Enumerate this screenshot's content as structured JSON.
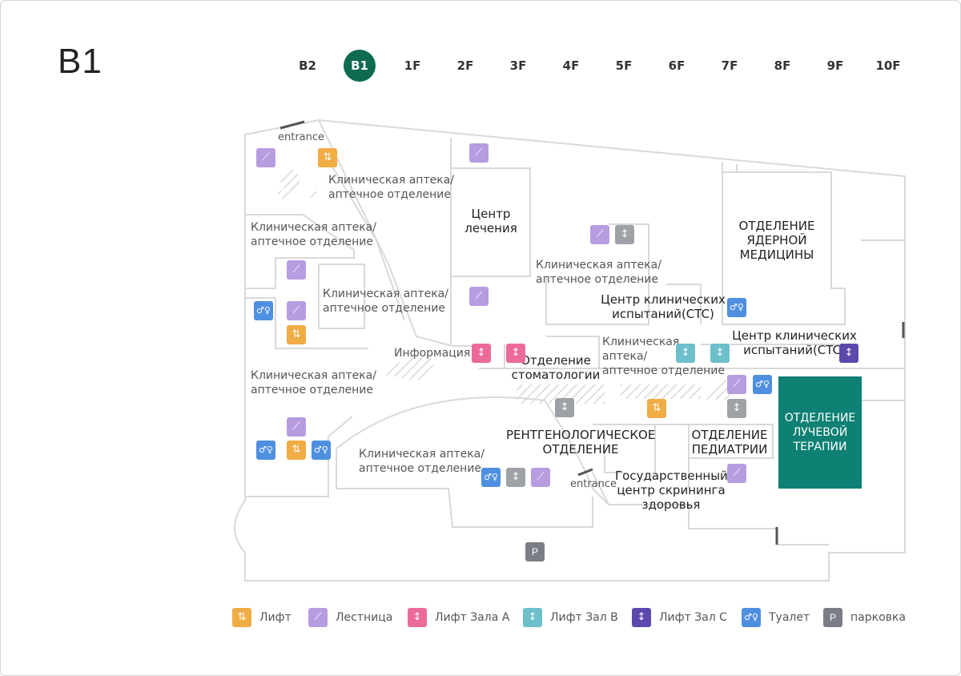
{
  "floor_title": "B1",
  "floor_nav": [
    "B2",
    "B1",
    "1F",
    "2F",
    "3F",
    "4F",
    "5F",
    "6F",
    "7F",
    "8F",
    "9F",
    "10F"
  ],
  "active_floor": "B1",
  "colors": {
    "active_floor": "#0e6b52",
    "radiation_highlight": "#0f8074",
    "elevator": "#f0ac45",
    "stairs": "#b89ce0",
    "lift_a": "#ec6a9a",
    "lift_b": "#6cbfcb",
    "lift_c": "#5e48ad",
    "toilet": "#4f8fe0",
    "parking": "#7a7e84"
  },
  "labels": {
    "entrance_top": "entrance",
    "entrance_bottom": "entrance",
    "pharmacy_1a": "Клиническая аптека/",
    "pharmacy_1b": "аптечное отделение",
    "pharmacy_2a": "Клиническая аптека/",
    "pharmacy_2b": "аптечное отделение",
    "pharmacy_3a": "Клиническая аптека/",
    "pharmacy_3b": "аптечное отделение",
    "pharmacy_4a": "Клиническая аптека/",
    "pharmacy_4b": "аптечное отделение",
    "pharmacy_5a": "Клиническая аптека/",
    "pharmacy_5b": "аптечное отделение",
    "pharmacy_6a": "Клиническая аптека/",
    "pharmacy_6b": "аптечное отделение",
    "pharmacy_7a": "Клиническая",
    "pharmacy_7b": "аптека/",
    "pharmacy_7c": "аптечное отделение",
    "treatment_a": "Центр",
    "treatment_b": "лечения",
    "nuclear_a": "ОТДЕЛЕНИЕ",
    "nuclear_b": "ЯДЕРНОЙ",
    "nuclear_c": "МЕДИЦИНЫ",
    "ctc1_a": "Центр клинических",
    "ctc1_b": "испытаний(CTC)",
    "ctc2_a": "Центр клинических",
    "ctc2_b": "испытаний(CTC)",
    "info": "Информация",
    "dental_a": "Отделение",
    "dental_b": "стоматологии",
    "radiology_a": "РЕНТГЕНОЛОГИЧЕСКОЕ",
    "radiology_b": "ОТДЕЛЕНИЕ",
    "pediatrics_a": "ОТДЕЛЕНИЕ",
    "pediatrics_b": "ПЕДИАТРИИ",
    "radiation_a": "ОТДЕЛЕНИЕ",
    "radiation_b": "ЛУЧЕВОЙ",
    "radiation_c": "ТЕРАПИИ",
    "screening_a": "Государственный",
    "screening_b": "центр скрининга",
    "screening_c": "здоровья",
    "parking_letter": "P"
  },
  "legend": [
    {
      "icon": "elevator-icon",
      "label": "Лифт"
    },
    {
      "icon": "stairs-icon",
      "label": "Лестница"
    },
    {
      "icon": "lift-a-icon",
      "label": "Лифт Зала A"
    },
    {
      "icon": "lift-b-icon",
      "label": "Лифт Зал B"
    },
    {
      "icon": "lift-c-icon",
      "label": "Лифт Зал C"
    },
    {
      "icon": "toilet-icon",
      "label": "Туалет"
    },
    {
      "icon": "parking-icon",
      "label": "парковка"
    }
  ]
}
